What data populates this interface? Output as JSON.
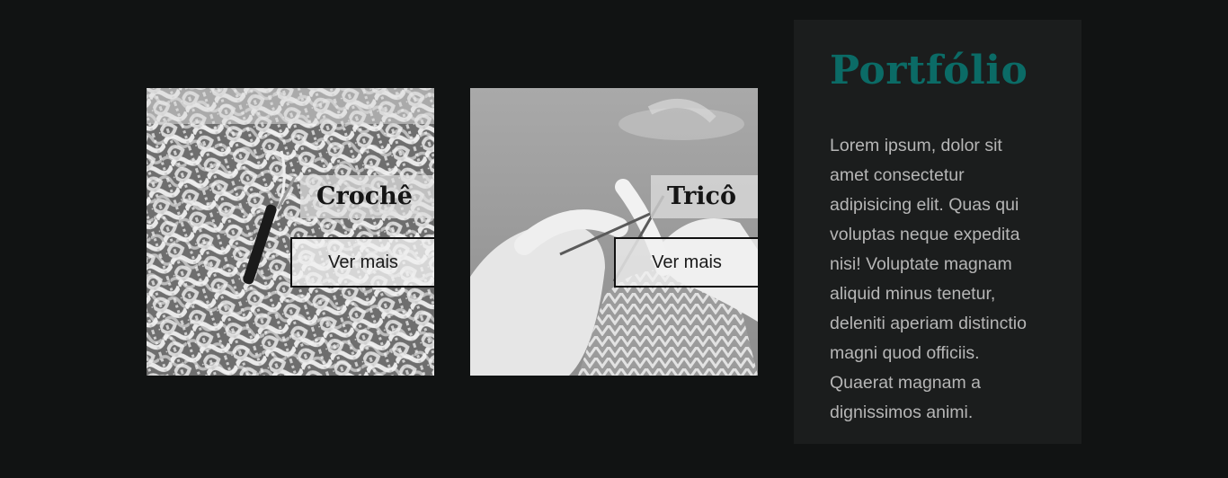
{
  "cards": [
    {
      "title": "Crochê",
      "button": "Ver mais",
      "image": "crochet-net-photo"
    },
    {
      "title": "Tricô",
      "button": "Ver mais",
      "image": "knitting-hands-photo"
    }
  ],
  "panel": {
    "title": "Portfólio",
    "text": "Lorem ipsum, dolor sit amet consectetur adipisicing elit. Quas qui voluptas neque expedita nisi! Voluptate magnam aliquid minus tenetur, deleniti aperiam distinctio magni quod officiis. Quaerat magnam a dignissimos animi."
  },
  "colors": {
    "background": "#111313",
    "panel": "#1b1d1d",
    "accent": "#0b6b66",
    "panel_text": "#b6b6b6"
  }
}
